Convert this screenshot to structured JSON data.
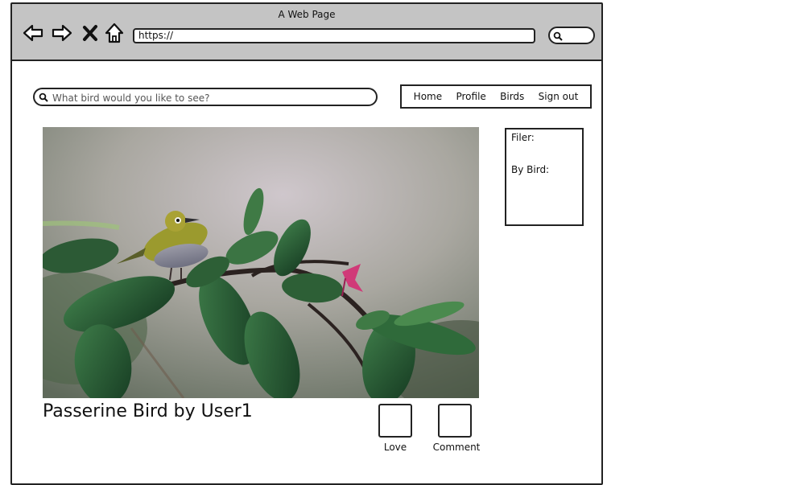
{
  "browser": {
    "window_title": "A Web Page",
    "url": "https://",
    "icons": [
      "back-arrow-icon",
      "forward-arrow-icon",
      "close-icon",
      "home-icon",
      "search-icon"
    ]
  },
  "site": {
    "search_placeholder": "What bird would you like to see?",
    "nav": [
      "Home",
      "Profile",
      "Birds",
      "Sign out"
    ]
  },
  "post": {
    "title": "Passerine Bird by User1",
    "love_label": "Love",
    "comment_label": "Comment"
  },
  "filter": {
    "heading": "Filer:",
    "by_bird_label": "By Bird:"
  }
}
